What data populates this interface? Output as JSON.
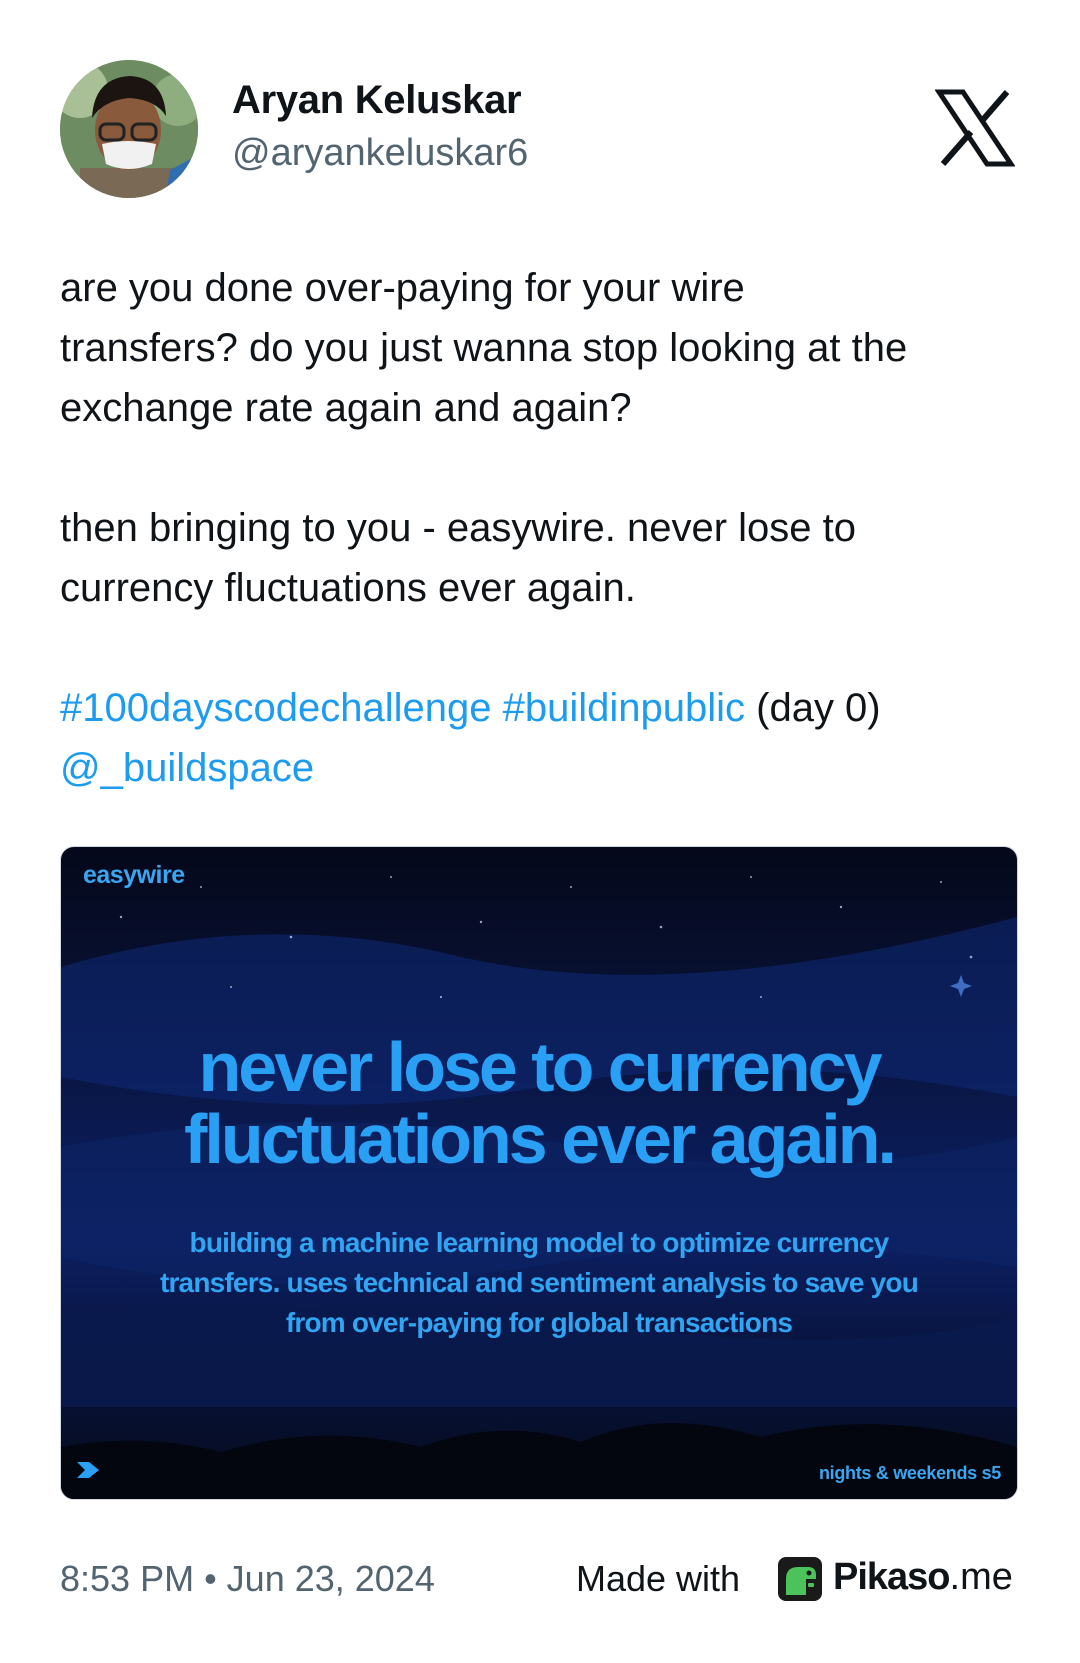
{
  "author": {
    "name": "Aryan Keluskar",
    "handle": "@aryankeluskar6"
  },
  "tweet": {
    "line1": "are you done over-paying for your wire",
    "line2": "transfers? do you just wanna stop looking at the",
    "line3": "exchange rate again and again?",
    "line4": "then bringing to you - easywire. never lose to",
    "line5": "currency fluctuations ever again.",
    "hashtag1": "#100dayscodechallenge",
    "hashtag2": "#buildinpublic",
    "day_text": "(day 0)",
    "mention": "@_buildspace"
  },
  "media": {
    "brand": "easywire",
    "headline_line1": "never lose to currency",
    "headline_line2": "fluctuations ever again.",
    "sub_line1": "building a machine learning model to optimize currency",
    "sub_line2": "transfers. uses technical and sentiment analysis to save you",
    "sub_line3": "from over-paying for global transactions",
    "footer_label": "nights & weekends s5"
  },
  "footer": {
    "timestamp": "8:53 PM • Jun 23, 2024",
    "made_with": "Made with",
    "pikaso_bold": "Pikaso",
    "pikaso_suffix": ".me"
  },
  "icons": {
    "platform": "x-logo-icon",
    "avatar": "avatar",
    "pikaso": "pikaso-dino-icon",
    "buildspace": "buildspace-logo-icon"
  },
  "colors": {
    "text": "#0f1419",
    "muted": "#536471",
    "link": "#1d9bf0",
    "media_accent": "#2aa0f5",
    "pikaso_green": "#4cc25a"
  }
}
